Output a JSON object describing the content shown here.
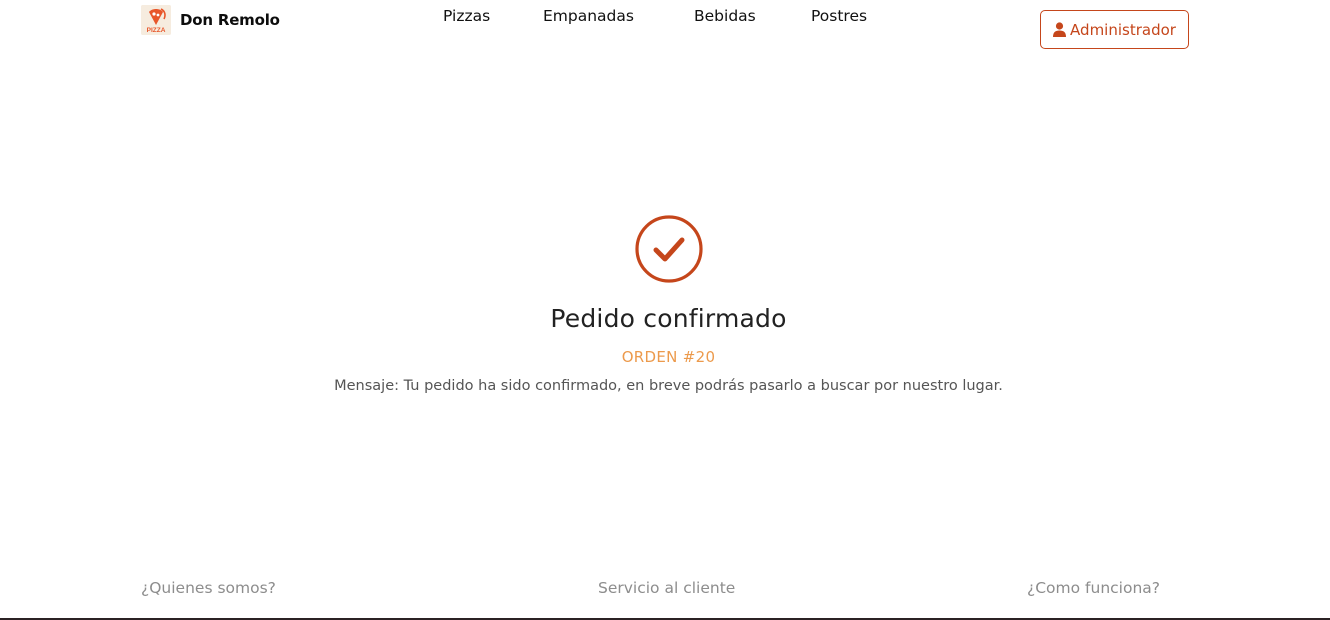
{
  "brand": {
    "name": "Don Remolo",
    "logo_text": "PIZZA"
  },
  "nav": {
    "items": [
      {
        "label": "Pizzas"
      },
      {
        "label": "Empanadas"
      },
      {
        "label": "Bebidas"
      },
      {
        "label": "Postres"
      }
    ]
  },
  "header": {
    "admin_label": "Administrador",
    "admin_icon": "user-icon"
  },
  "confirmation": {
    "icon": "check-circle-icon",
    "title": "Pedido confirmado",
    "order": "ORDEN #20",
    "message": "Mensaje: Tu pedido ha sido confirmado, en breve podrás pasarlo a buscar por nuestro lugar."
  },
  "footer": {
    "links": [
      {
        "label": "¿Quienes somos?"
      },
      {
        "label": "Servicio al cliente"
      },
      {
        "label": "¿Como funciona?"
      }
    ]
  },
  "colors": {
    "accent": "#c5461b",
    "order_orange": "#ec9a4c",
    "footer_text": "#8d8d8d"
  }
}
